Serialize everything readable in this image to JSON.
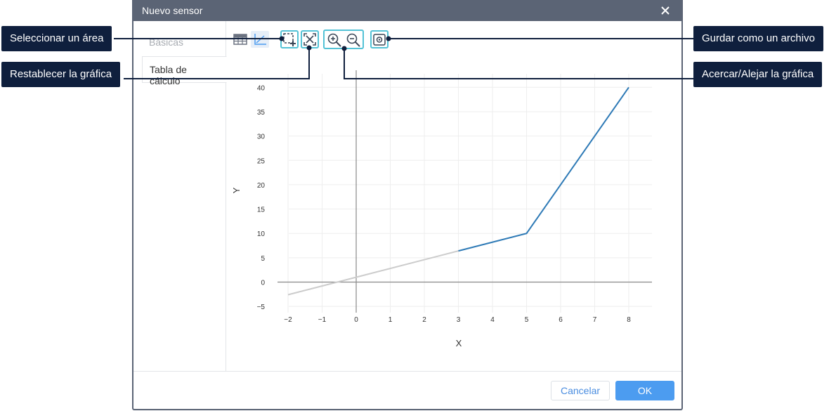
{
  "dialog": {
    "title": "Nuevo sensor",
    "tabs": [
      "Básicas",
      "Tabla de cálculo"
    ],
    "cancel_label": "Cancelar",
    "ok_label": "OK"
  },
  "toolbar": {
    "icons": [
      "table-view-icon",
      "chart-view-icon",
      "select-area-icon",
      "reset-chart-icon",
      "zoom-in-icon",
      "zoom-out-icon",
      "save-file-icon"
    ]
  },
  "callouts": {
    "select_area": "Seleccionar un área",
    "reset_chart": "Restablecer la gráfica",
    "save_file": "Gurdar como un archivo",
    "zoom": "Acercar/Alejar la gráfica"
  },
  "colors": {
    "title_bar": "#5b6475",
    "accent": "#4c9cf0",
    "highlight": "#53c2d6",
    "callout_bg": "#0f1f3d",
    "series_active": "#2e7ab6",
    "series_inactive": "#cccccc"
  },
  "chart_data": {
    "type": "line",
    "xlabel": "X",
    "ylabel": "Y",
    "xlim": [
      -2,
      8
    ],
    "ylim": [
      -5,
      40
    ],
    "xticks": [
      "−2",
      "−1",
      "0",
      "1",
      "2",
      "3",
      "4",
      "5",
      "6",
      "7",
      "8"
    ],
    "yticks": [
      "−5",
      "0",
      "5",
      "10",
      "15",
      "20",
      "25",
      "30",
      "35",
      "40"
    ],
    "grid": true,
    "series": [
      {
        "color": "#cccccc",
        "x": [
          -2,
          3
        ],
        "y": [
          -2.6,
          6.4
        ]
      },
      {
        "color": "#2e7ab6",
        "x": [
          3,
          5,
          8
        ],
        "y": [
          6.4,
          10,
          40
        ]
      }
    ]
  }
}
